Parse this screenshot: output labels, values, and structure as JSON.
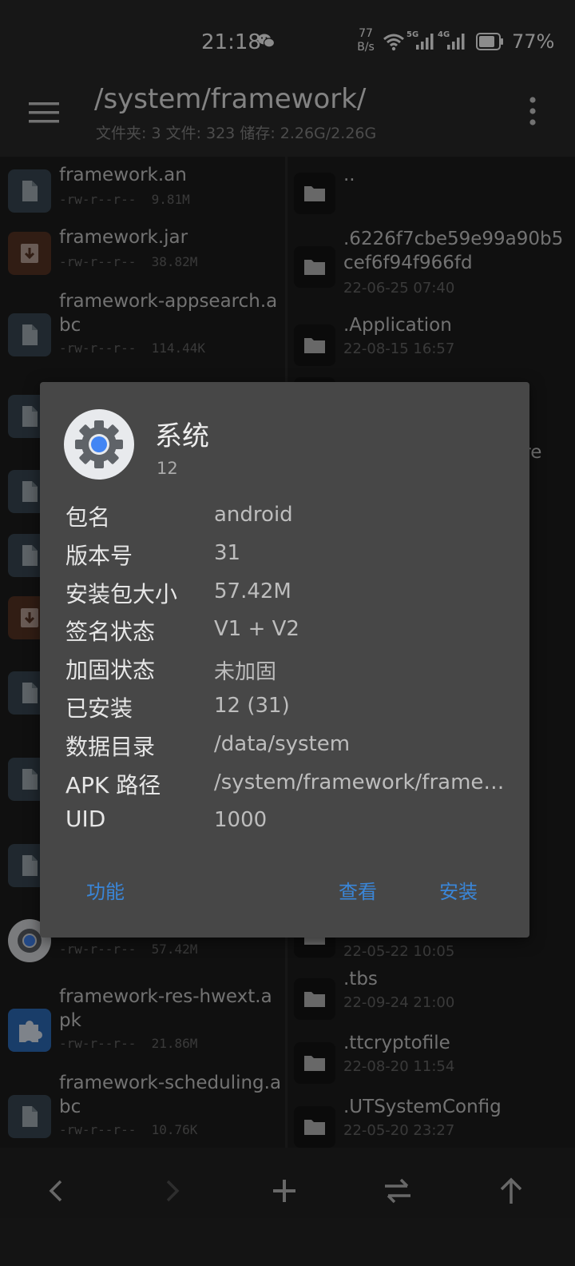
{
  "status_bar": {
    "time": "21:18",
    "net_speed_value": "77",
    "net_speed_unit": "B/s",
    "sig1_label": "5G",
    "sig2_label": "4G",
    "battery": "77%"
  },
  "header": {
    "path": "/system/framework/",
    "summary": "文件夹: 3  文件: 323  储存: 2.26G/2.26G"
  },
  "left_files": [
    {
      "name": "framework.an",
      "meta": "-rw-r--r--  9.81M",
      "icon": "file-icon"
    },
    {
      "name": "framework.jar",
      "meta": "-rw-r--r--  38.82M",
      "icon": "archive-icon"
    },
    {
      "name": "framework-appsearch.abc",
      "meta": "-rw-r--r--  114.44K",
      "icon": "file-icon"
    },
    {
      "name": "",
      "meta": "",
      "icon": "file-icon"
    },
    {
      "name": "",
      "meta": "",
      "icon": "file-icon"
    },
    {
      "name": "",
      "meta": "",
      "icon": "file-icon"
    },
    {
      "name": "",
      "meta": "",
      "icon": "archive-icon"
    },
    {
      "name": "",
      "meta": "",
      "icon": "file-icon"
    },
    {
      "name": "",
      "meta": "",
      "icon": "file-icon"
    },
    {
      "name": "",
      "meta": "",
      "icon": "file-icon"
    },
    {
      "name": "",
      "meta": "-rw-r--r--  57.42M",
      "icon": "android-settings-icon"
    },
    {
      "name": "framework-res-hwext.apk",
      "meta": "-rw-r--r--  21.86M",
      "icon": "puzzle-icon"
    },
    {
      "name": "framework-scheduling.abc",
      "meta": "-rw-r--r--  10.76K",
      "icon": "file-icon"
    }
  ],
  "right_files": [
    {
      "name": "..",
      "date": ""
    },
    {
      "name": ".6226f7cbe59e99a90b5cef6f94f966fd",
      "date": "22-06-25 07:40"
    },
    {
      "name": ".Application",
      "date": "22-08-15 16:57"
    },
    {
      "name": "",
      "date": ""
    },
    {
      "name": "",
      "date": "22-05-22 10:05"
    },
    {
      "name": ".tbs",
      "date": "22-09-24 21:00"
    },
    {
      "name": ".ttcryptofile",
      "date": "22-08-20 11:54"
    },
    {
      "name": ".UTSystemConfig",
      "date": "22-05-20 23:27"
    }
  ],
  "right_partial": ".re",
  "dialog": {
    "title": "系统",
    "subtitle": "12",
    "rows": [
      {
        "label": "包名",
        "value": "android"
      },
      {
        "label": "版本号",
        "value": "31"
      },
      {
        "label": "安装包大小",
        "value": "57.42M"
      },
      {
        "label": "签名状态",
        "value": "V1 + V2"
      },
      {
        "label": "加固状态",
        "value": "未加固"
      },
      {
        "label": "已安装",
        "value": "12 (31)"
      },
      {
        "label": "数据目录",
        "value": "/data/system"
      },
      {
        "label": "APK 路径",
        "value": "/system/framework/framework-res.apk"
      },
      {
        "label": "UID",
        "value": "1000"
      }
    ],
    "btn_function": "功能",
    "btn_view": "查看",
    "btn_install": "安装"
  },
  "colors": {
    "accent": "#3a86d8",
    "file_icon_bg": "#3b4a56",
    "archive_icon_bg": "#5a3526",
    "puzzle_icon_bg": "#2f6fc0"
  }
}
